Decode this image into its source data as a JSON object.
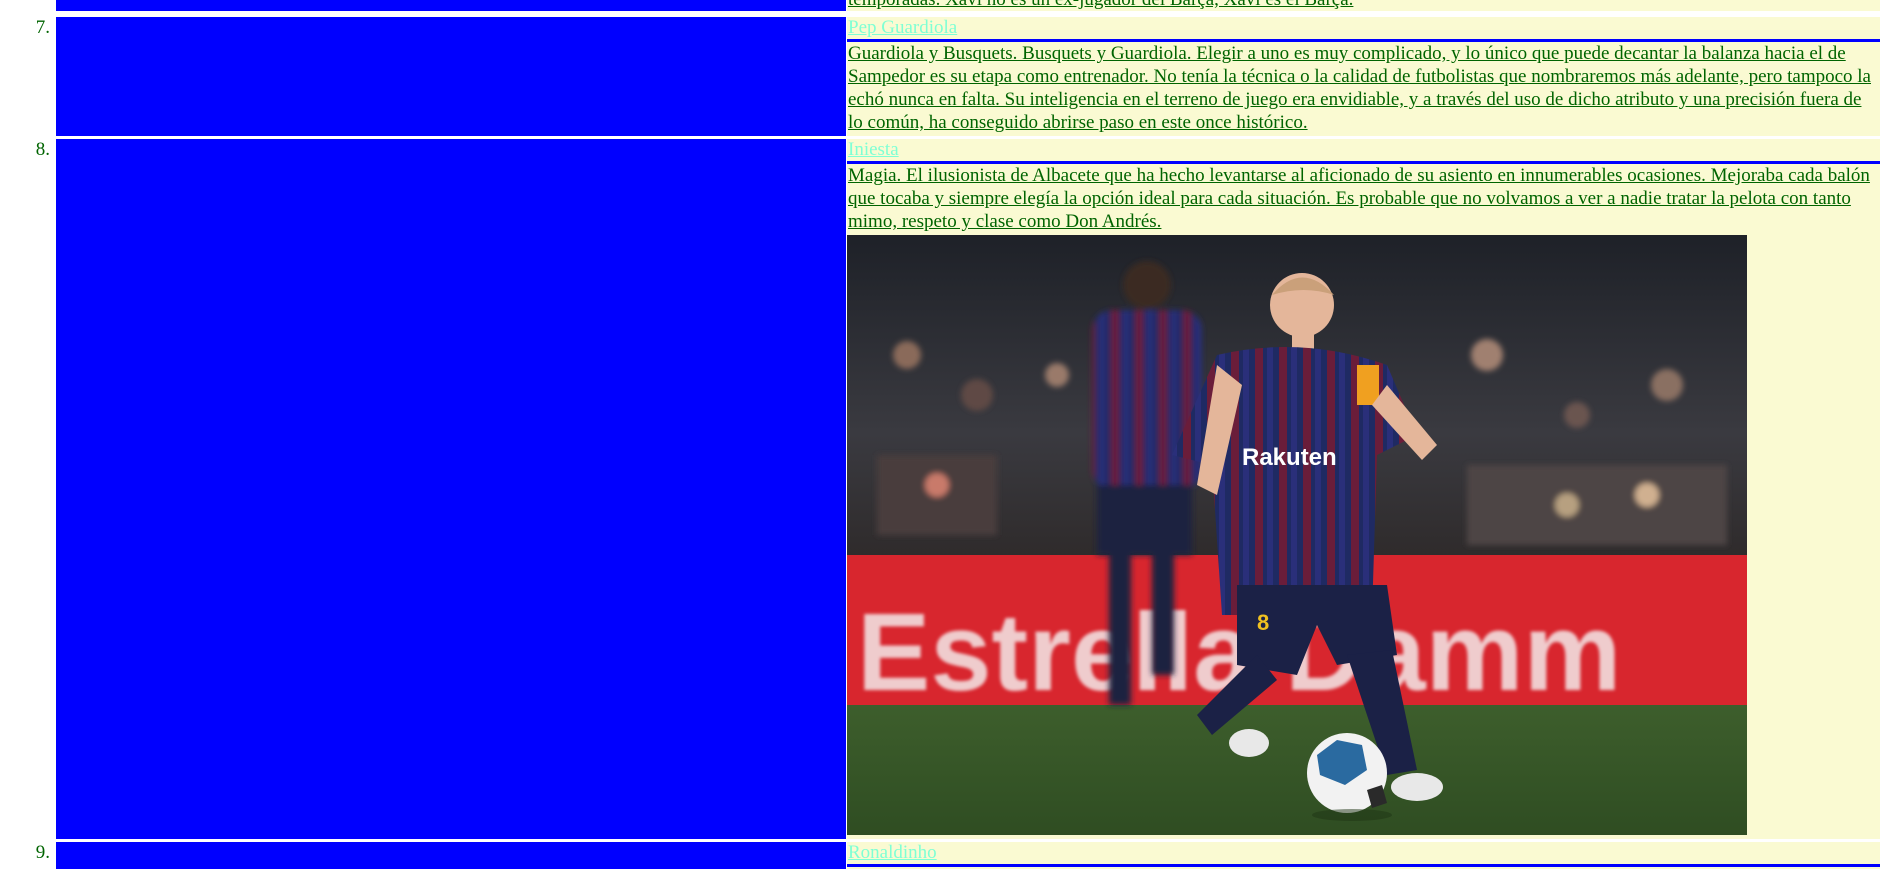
{
  "top_partial": {
    "desc": "temporadas. Xavi no es un ex-jugador del Barça, Xavi es el Barça."
  },
  "entries": [
    {
      "number": "7.",
      "title": "Pep Guardiola",
      "desc": "Guardiola y Busquets. Busquets y Guardiola. Elegir a uno es muy complicado, y lo único que puede decantar la balanza hacia el de Sampedor es su etapa como entrenador. No tenía la técnica o la calidad de futbolistas que nombraremos más adelante, pero tampoco la echó nunca en falta. Su inteligencia en el terreno de juego era envidiable, y a través del uso de dicho atributo y una precisión fuera de lo común, ha conseguido abrirse paso en este once histórico."
    },
    {
      "number": "8.",
      "title": "Iniesta",
      "desc": "Magia. El ilusionista de Albacete que ha hecho levantarse al aficionado de su asiento en innumerables ocasiones. Mejoraba cada balón que tocaba y siempre elegía la opción ideal para cada situación. Es probable que no volvamos a ver a nadie tratar la pelota con tanto mimo, respeto y clase como Don Andrés.",
      "photo": {
        "banner_text": "Estrella Damm",
        "shirt_text": "Rakuten",
        "shirt_number": "8"
      }
    },
    {
      "number": "9.",
      "title": "Ronaldinho"
    }
  ],
  "colors": {
    "blue_cell": "#0000ff",
    "right_bg": "#fafad2",
    "link": "#7fffd4",
    "text": "#006400"
  }
}
